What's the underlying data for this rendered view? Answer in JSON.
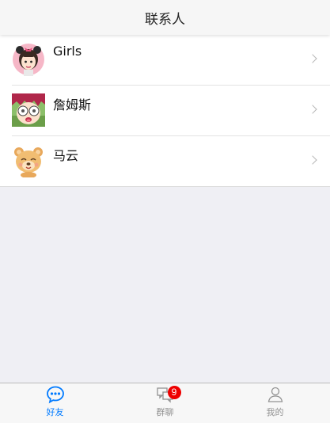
{
  "header": {
    "title": "联系人"
  },
  "contacts": [
    {
      "name": "Girls",
      "avatar": "girl-avatar-icon"
    },
    {
      "name": "詹姆斯",
      "avatar": "anime-boy-avatar-icon"
    },
    {
      "name": "马云",
      "avatar": "bear-avatar-icon"
    }
  ],
  "tabs": [
    {
      "label": "好友",
      "icon": "chat-bubble-icon",
      "active": true
    },
    {
      "label": "群聊",
      "icon": "group-chat-icon",
      "badge": "9"
    },
    {
      "label": "我的",
      "icon": "person-icon"
    }
  ],
  "colors": {
    "accent": "#007aff",
    "badge": "#e00000",
    "background": "#efeff4"
  }
}
